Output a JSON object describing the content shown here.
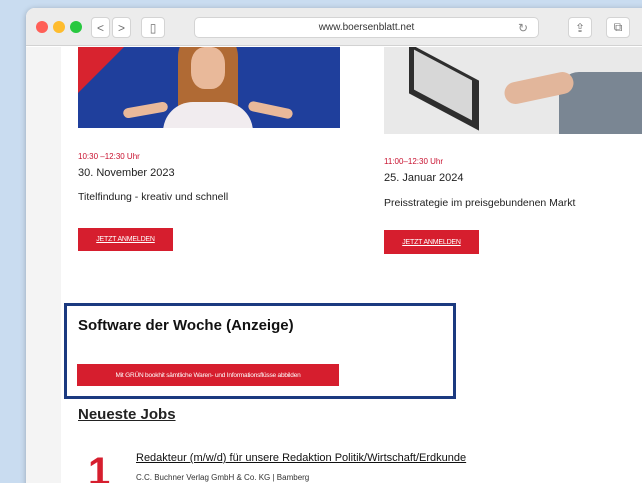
{
  "browser": {
    "url": "www.boersenblatt.net",
    "back_icon": "<",
    "forward_icon": ">",
    "sidebar_icon": "▯",
    "reload_icon": "↻",
    "share_icon": "⇪",
    "tabs_icon": "⧉"
  },
  "events": [
    {
      "time": "10:30 –12:30 Uhr",
      "date": "30. November 2023",
      "title": "Titelfindung - kreativ und schnell",
      "button": "JETZT ANMELDEN"
    },
    {
      "time": "11:00–12:30 Uhr",
      "date": "25. Januar 2024",
      "title": "Preisstrategie im preisgebundenen Markt",
      "button": "JETZT ANMELDEN"
    }
  ],
  "software": {
    "heading": "Software der Woche (Anzeige)",
    "button": "Mit GRÜN bookhit sämtliche Waren- und Informationsflüsse abbilden"
  },
  "jobs": {
    "heading": "Neueste Jobs",
    "items": [
      {
        "number": "1",
        "title": "Redakteur (m/w/d) für unsere Redaktion Politik/Wirtschaft/Erdkunde",
        "company": "C.C. Buchner Verlag GmbH & Co. KG | Bamberg"
      }
    ]
  },
  "colors": {
    "accent_red": "#d61e2e",
    "box_blue": "#1b3a80",
    "time_red": "#c8102e"
  }
}
